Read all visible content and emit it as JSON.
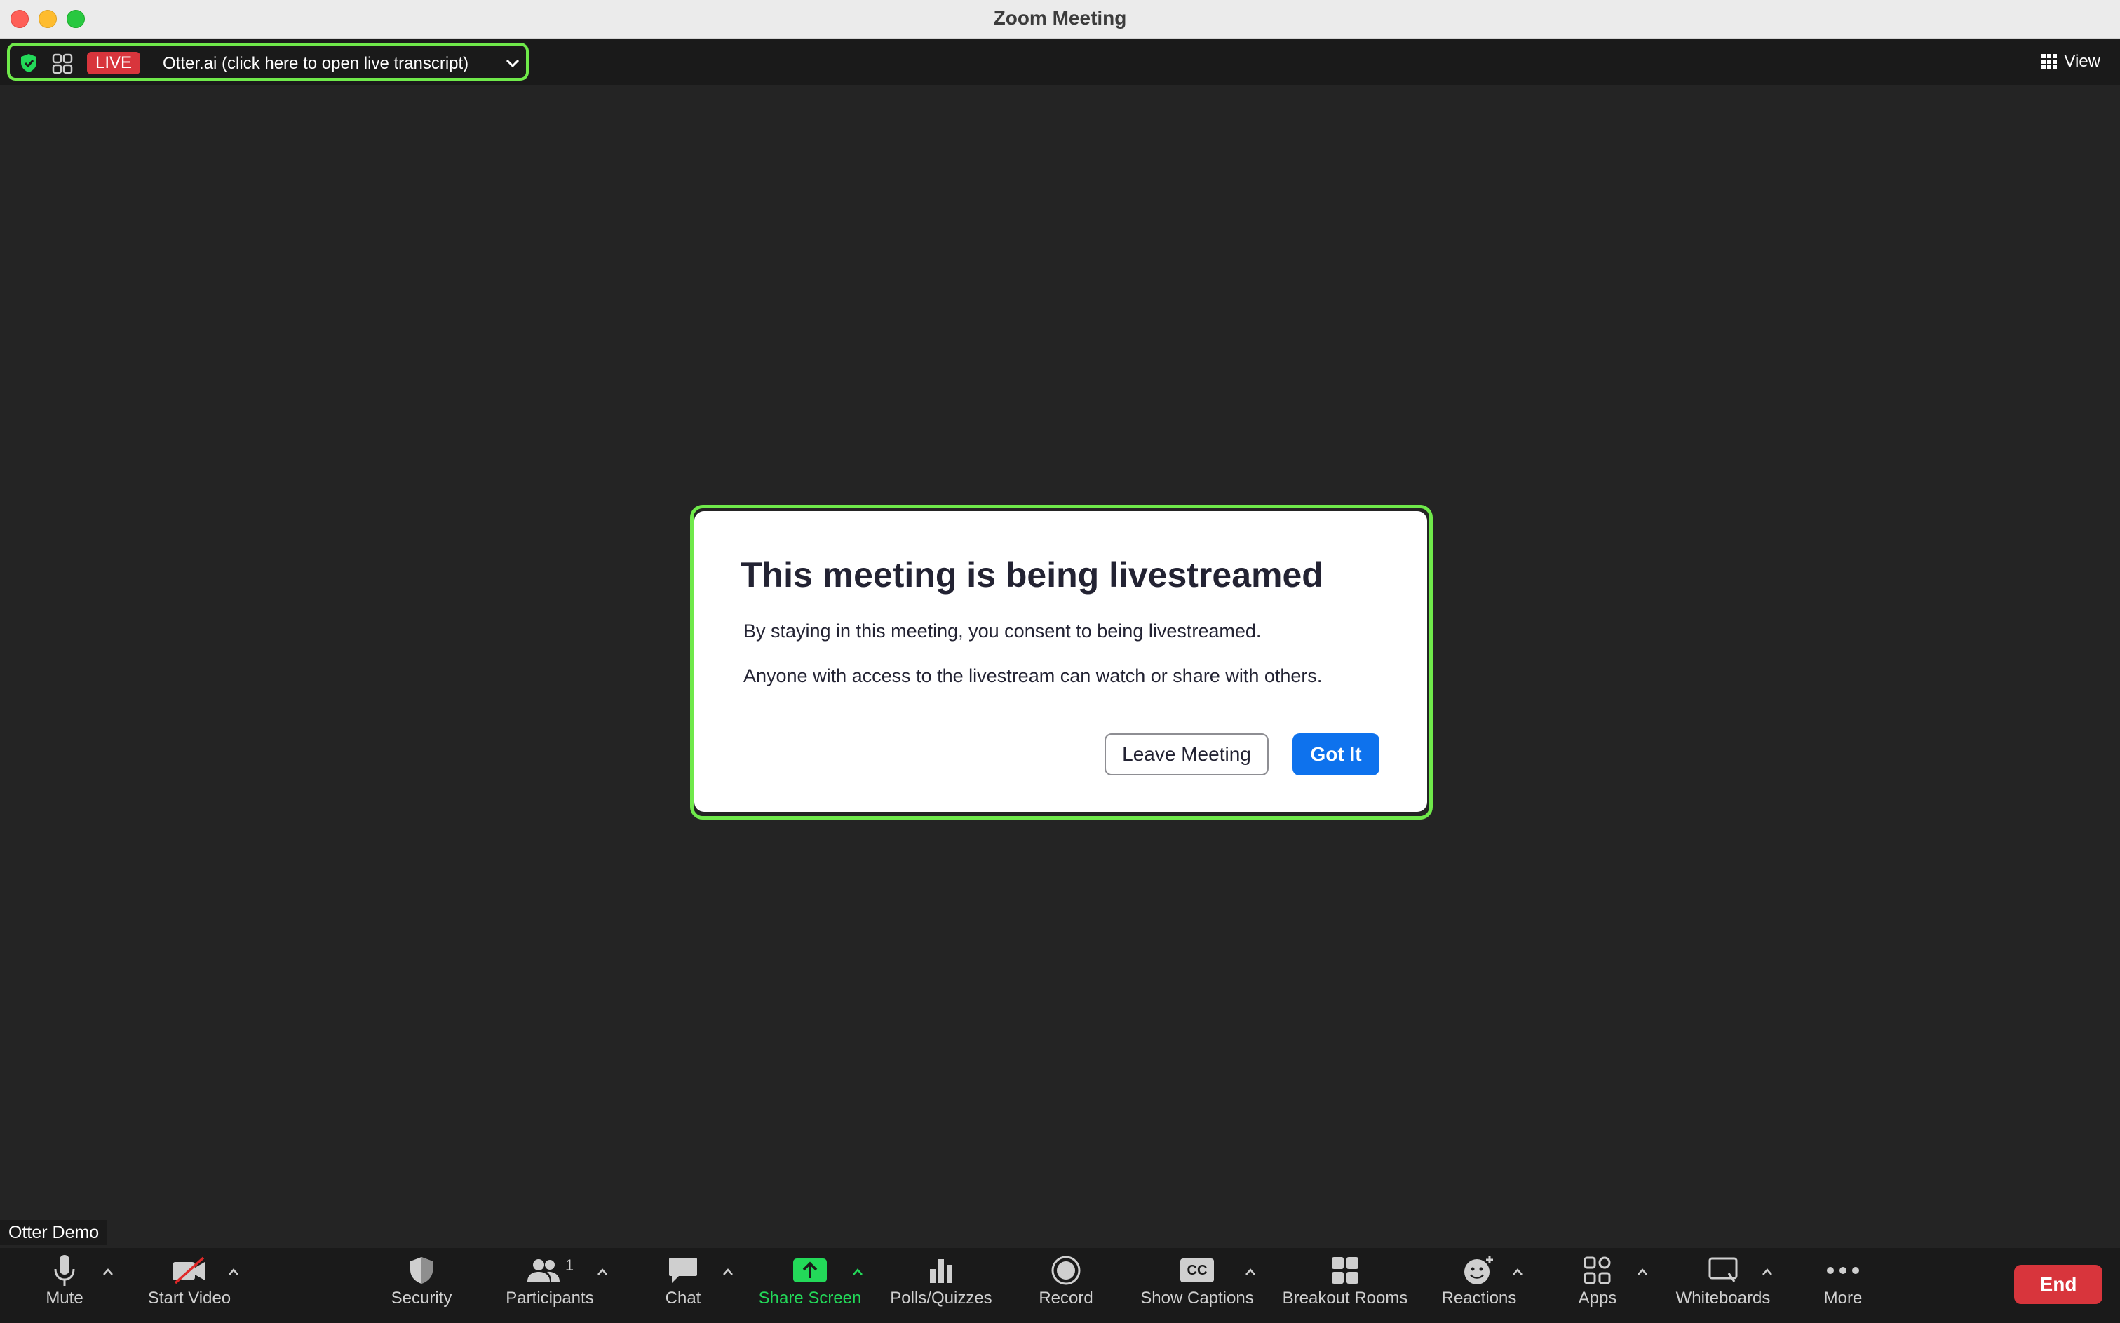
{
  "window": {
    "title": "Zoom Meeting"
  },
  "topbar": {
    "live_badge": "LIVE",
    "otter_label": "Otter.ai (click here to open live transcript)",
    "view_label": "View"
  },
  "modal": {
    "title": "This meeting is being livestreamed",
    "line1": "By staying in this meeting, you consent to being livestreamed.",
    "line2": "Anyone with access to the livestream can watch or share with others.",
    "leave_label": "Leave Meeting",
    "gotit_label": "Got It"
  },
  "participant": {
    "name": "Otter Demo"
  },
  "toolbar": {
    "mute": "Mute",
    "start_video": "Start Video",
    "security": "Security",
    "participants": "Participants",
    "participants_count": "1",
    "chat": "Chat",
    "share_screen": "Share Screen",
    "polls": "Polls/Quizzes",
    "record": "Record",
    "show_captions": "Show Captions",
    "cc_text": "CC",
    "breakout": "Breakout Rooms",
    "reactions": "Reactions",
    "apps": "Apps",
    "whiteboards": "Whiteboards",
    "more": "More",
    "end": "End"
  },
  "colors": {
    "highlight": "#6fe94a",
    "live_red": "#d8353c",
    "primary_blue": "#0e72ed",
    "share_green": "#23d959"
  }
}
